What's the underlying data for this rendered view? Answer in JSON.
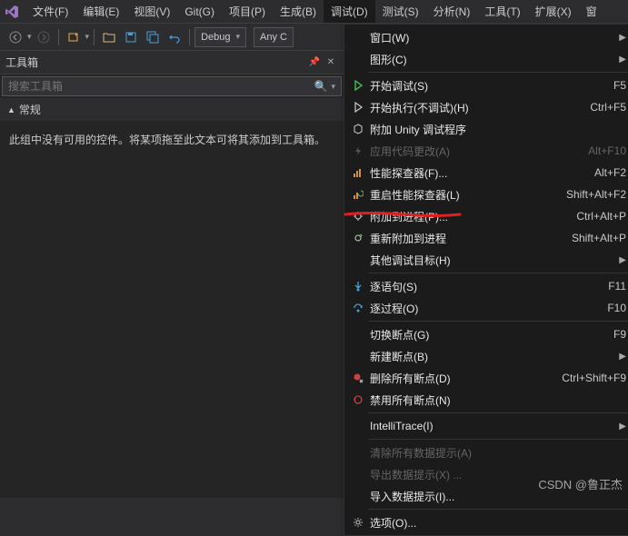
{
  "menubar": {
    "items": [
      "文件(F)",
      "编辑(E)",
      "视图(V)",
      "Git(G)",
      "项目(P)",
      "生成(B)",
      "调试(D)",
      "测试(S)",
      "分析(N)",
      "工具(T)",
      "扩展(X)",
      "窗"
    ],
    "activeIndex": 6
  },
  "toolbar": {
    "config": "Debug",
    "platform": "Any C"
  },
  "toolbox": {
    "title": "工具箱",
    "search_placeholder": "搜索工具箱",
    "section": "常规",
    "empty_text": "此组中没有可用的控件。将某项拖至此文本可将其添加到工具箱。"
  },
  "debug_menu": {
    "windows": "窗口(W)",
    "graphics": "图形(C)",
    "start_debug": {
      "label": "开始调试(S)",
      "shortcut": "F5"
    },
    "start_no_debug": {
      "label": "开始执行(不调试)(H)",
      "shortcut": "Ctrl+F5"
    },
    "attach_unity": "附加 Unity 调试程序",
    "apply_code_changes": {
      "label": "应用代码更改(A)",
      "shortcut": "Alt+F10"
    },
    "perf_profiler": {
      "label": "性能探查器(F)...",
      "shortcut": "Alt+F2"
    },
    "relaunch_profiler": {
      "label": "重启性能探查器(L)",
      "shortcut": "Shift+Alt+F2"
    },
    "attach_process": {
      "label": "附加到进程(P)...",
      "shortcut": "Ctrl+Alt+P"
    },
    "reattach": {
      "label": "重新附加到进程",
      "shortcut": "Shift+Alt+P"
    },
    "other_targets": "其他调试目标(H)",
    "step_into": {
      "label": "逐语句(S)",
      "shortcut": "F11"
    },
    "step_over": {
      "label": "逐过程(O)",
      "shortcut": "F10"
    },
    "toggle_bp": {
      "label": "切换断点(G)",
      "shortcut": "F9"
    },
    "new_bp": "新建断点(B)",
    "delete_all_bp": {
      "label": "删除所有断点(D)",
      "shortcut": "Ctrl+Shift+F9"
    },
    "disable_all_bp": "禁用所有断点(N)",
    "intellitrace": "IntelliTrace(I)",
    "clear_datatips": "清除所有数据提示(A)",
    "export_datatips": "导出数据提示(X) ...",
    "import_datatips": "导入数据提示(I)...",
    "options": "选项(O)..."
  },
  "watermark": "CSDN @鲁正杰"
}
